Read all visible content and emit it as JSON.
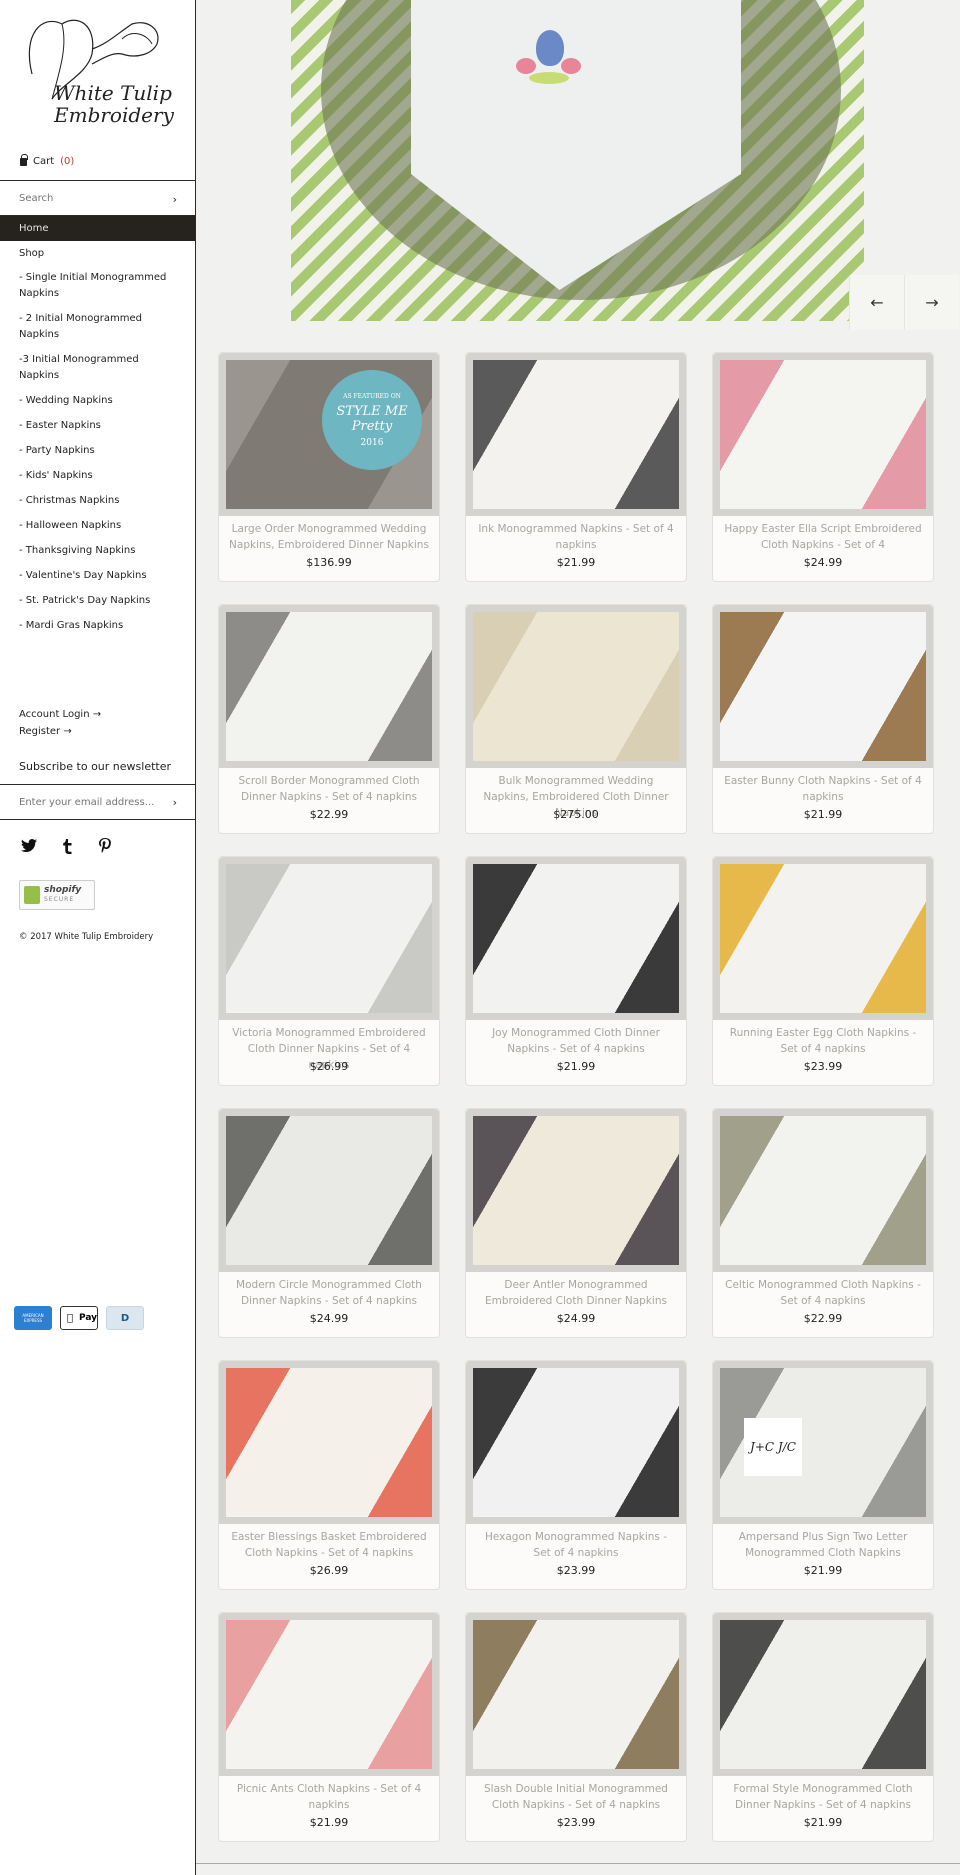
{
  "brand": {
    "line1": "White Tulip",
    "line2": "Embroidery"
  },
  "cart": {
    "label": "Cart",
    "count": "(0)"
  },
  "search": {
    "placeholder": "Search"
  },
  "nav": {
    "home": "Home",
    "shop": "Shop",
    "items": [
      "- Single Initial Monogrammed Napkins",
      "- 2 Initial Monogrammed Napkins",
      "-3 Initial Monogrammed Napkins",
      "- Wedding Napkins",
      "- Easter Napkins",
      "- Party Napkins",
      "- Kids' Napkins",
      "- Christmas Napkins",
      "- Halloween Napkins",
      "- Thanksgiving Napkins",
      "- Valentine's Day Napkins",
      "- St. Patrick's Day Napkins",
      "- Mardi Gras Napkins"
    ]
  },
  "account": {
    "login": "Account Login →",
    "register": "Register →"
  },
  "newsletter": {
    "title": "Subscribe to our newsletter",
    "placeholder": "Enter your email address..."
  },
  "social_icons": [
    "twitter-icon",
    "tumblr-icon",
    "pinterest-icon"
  ],
  "badge": {
    "main": "shopify",
    "sub": "SECURE"
  },
  "copyright": "© 2017 White Tulip Embroidery",
  "payments": {
    "amex": "AMERICAN EXPRESS",
    "apple": "Pay",
    "diners": "D"
  },
  "hero": {
    "prev": "←",
    "next": "→"
  },
  "products": [
    {
      "title": "Large Order Monogrammed Wedding Napkins, Embroidered Dinner Napkins",
      "price": "$136.99",
      "badge": "STYLE ME Pretty",
      "badge_top": "AS FEATURED ON",
      "badge_year": "2016",
      "colors": [
        "#7f7a73",
        "#9a958e"
      ]
    },
    {
      "title": "Ink Monogrammed Napkins - Set of 4 napkins",
      "price": "$21.99",
      "colors": [
        "#f3f2ee",
        "#5a5a5a"
      ]
    },
    {
      "title": "Happy Easter Ella Script Embroidered Cloth Napkins - Set of 4",
      "price": "$24.99",
      "colors": [
        "#f4f4f1",
        "#e59aa7"
      ]
    },
    {
      "title": "Scroll Border Monogrammed Cloth Dinner Napkins - Set of 4 napkins",
      "price": "$22.99",
      "colors": [
        "#f2f2ef",
        "#8d8c89"
      ]
    },
    {
      "title": "Bulk Monogrammed Wedding Napkins, Embroidered Cloth Dinner Napkins",
      "price": "$275.00",
      "colors": [
        "#ece5d2",
        "#d9cfb5"
      ]
    },
    {
      "title": "Easter Bunny Cloth Napkins - Set of 4 napkins",
      "price": "$21.99",
      "colors": [
        "#f4f4f4",
        "#9c7a52"
      ]
    },
    {
      "title": "Victoria Monogrammed Embroidered Cloth Dinner Napkins - Set of 4 napkins",
      "price": "$26.99",
      "colors": [
        "#f1f1ef",
        "#c9c9c6"
      ]
    },
    {
      "title": "Joy Monogrammed Cloth Dinner Napkins - Set of 4 napkins",
      "price": "$21.99",
      "colors": [
        "#f2f2f0",
        "#3a3a3a"
      ]
    },
    {
      "title": "Running Easter Egg Cloth Napkins - Set of 4 napkins",
      "price": "$23.99",
      "colors": [
        "#f3f2ee",
        "#e6b94a"
      ]
    },
    {
      "title": "Modern Circle Monogrammed Cloth Dinner Napkins - Set of 4 napkins",
      "price": "$24.99",
      "colors": [
        "#e9e9e5",
        "#6f6f6c"
      ]
    },
    {
      "title": "Deer Antler Monogrammed Embroidered Cloth Dinner Napkins",
      "price": "$24.99",
      "colors": [
        "#efe9dc",
        "#5a5458"
      ]
    },
    {
      "title": "Celtic Monogrammed Cloth Napkins - Set of 4 napkins",
      "price": "$22.99",
      "colors": [
        "#f2f2ef",
        "#a1a08a"
      ]
    },
    {
      "title": "Easter Blessings Basket Embroidered Cloth Napkins - Set of 4 napkins",
      "price": "$26.99",
      "colors": [
        "#f5f1ea",
        "#e67460"
      ]
    },
    {
      "title": "Hexagon Monogrammed Napkins - Set of 4 napkins",
      "price": "$23.99",
      "colors": [
        "#f1f1f1",
        "#3b3b3b"
      ]
    },
    {
      "title": "Ampersand Plus Sign Two Letter Monogrammed Cloth Napkins",
      "price": "$21.99",
      "badge": "J+C J/C",
      "colors": [
        "#ecece9",
        "#9a9a96"
      ]
    },
    {
      "title": "Picnic Ants Cloth Napkins - Set of 4 napkins",
      "price": "$21.99",
      "colors": [
        "#f4f3ef",
        "#e8a0a0"
      ]
    },
    {
      "title": "Slash Double Initial Monogrammed Cloth Napkins - Set of 4 napkins",
      "price": "$23.99",
      "colors": [
        "#f2f1ee",
        "#8f7d5f"
      ]
    },
    {
      "title": "Formal Style Monogrammed Cloth Dinner Napkins - Set of 4 napkins",
      "price": "$21.99",
      "colors": [
        "#efefec",
        "#4e4e4c"
      ]
    }
  ]
}
